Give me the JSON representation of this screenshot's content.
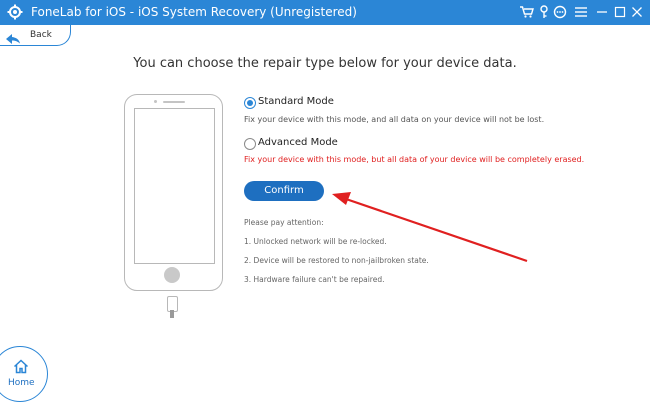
{
  "titlebar": {
    "title": "FoneLab for iOS - iOS System Recovery (Unregistered)",
    "bg_color": "#2b86d6",
    "icons": [
      "cart-icon",
      "key-icon",
      "chat-icon",
      "menu-icon",
      "minimize-icon",
      "maximize-icon",
      "close-icon"
    ]
  },
  "nav": {
    "back_label": "Back",
    "home_label": "Home"
  },
  "main": {
    "heading": "You can choose the repair type below for your device data.",
    "options": [
      {
        "label": "Standard Mode",
        "description": "Fix your device with this mode, and all data on your device will not be lost.",
        "selected": true
      },
      {
        "label": "Advanced Mode",
        "description": "Fix your device with this mode, but all data of your device will be completely erased.",
        "selected": false,
        "description_color": "#e02020"
      }
    ],
    "confirm_label": "Confirm",
    "notes_title": "Please pay attention:",
    "notes": [
      "1. Unlocked network will be re-locked.",
      "2. Device will be restored to non-jailbroken state.",
      "3. Hardware failure can't be repaired."
    ]
  },
  "annotation_arrow_color": "#e02020"
}
